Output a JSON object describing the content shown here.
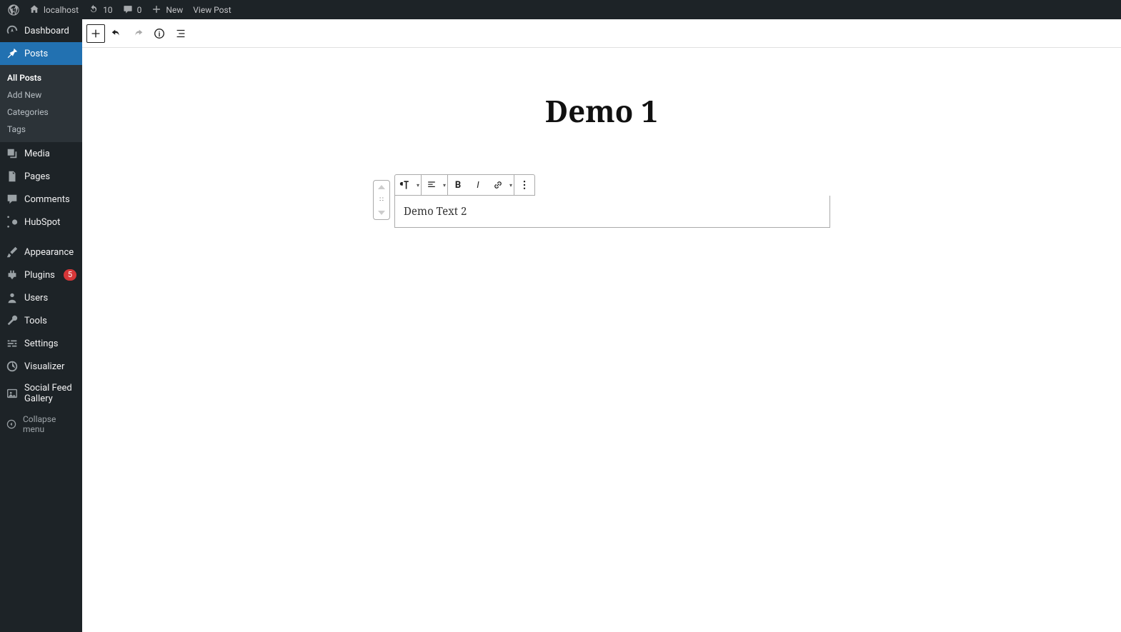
{
  "adminbar": {
    "site": "localhost",
    "updates": "10",
    "comments": "0",
    "new": "New",
    "view_post": "View Post"
  },
  "sidebar": {
    "dashboard": "Dashboard",
    "posts": "Posts",
    "posts_sub": {
      "all": "All Posts",
      "add": "Add New",
      "categories": "Categories",
      "tags": "Tags"
    },
    "media": "Media",
    "pages": "Pages",
    "comments": "Comments",
    "hubspot": "HubSpot",
    "appearance": "Appearance",
    "plugins": "Plugins",
    "plugins_badge": "5",
    "users": "Users",
    "tools": "Tools",
    "settings": "Settings",
    "visualizer": "Visualizer",
    "social_feed": "Social Feed Gallery",
    "collapse": "Collapse menu"
  },
  "editor": {
    "title": "Demo 1",
    "block_text": "Demo Text 2"
  }
}
